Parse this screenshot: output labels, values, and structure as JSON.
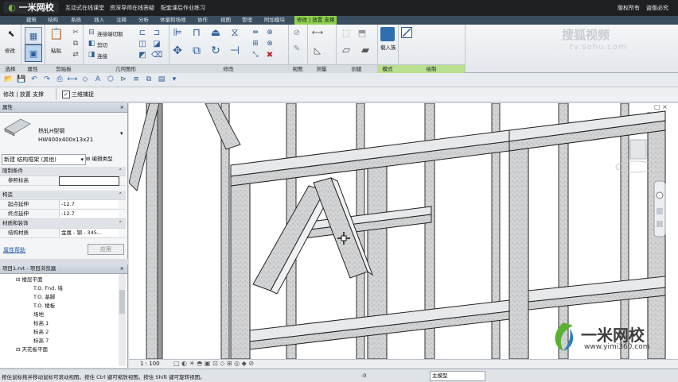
{
  "banner": {
    "logo": "一米网校",
    "links": [
      "互动式在线课堂",
      "资深导师在线答疑",
      "配套课后作业练习"
    ],
    "right": [
      "版权所有",
      "盗版必究"
    ]
  },
  "ribbon_tabs": [
    "建筑",
    "结构",
    "系统",
    "插入",
    "注释",
    "分析",
    "体量和场地",
    "协作",
    "视图",
    "管理",
    "附加模块",
    "修改 | 放置 支撑"
  ],
  "active_tab": "修改 | 放置 支撑",
  "ribbon": {
    "groups": [
      "选择",
      "属性",
      "剪贴板",
      "几何图形",
      "修改",
      "视图",
      "测量",
      "创建",
      "模式",
      "绘制"
    ],
    "modify_label": "修改",
    "paste_label": "粘贴",
    "join_label": "连接端切割",
    "cut_label": "剪切",
    "join2_label": "连接",
    "load_family": "载入族"
  },
  "watermark": {
    "line1": "搜狐视频",
    "line2": "tv.sohu.com"
  },
  "options_bar": {
    "context": "修改 | 放置 支撑",
    "checkbox_label": "三维捕捉"
  },
  "properties": {
    "title": "属性",
    "type_name": "热轧H型钢",
    "type_size": "HW400x400x13x21",
    "selector": "新建 结构框架 (其他)",
    "edit_type": "编辑类型",
    "sections": [
      {
        "name": "限制条件",
        "rows": [
          {
            "name": "参照标高",
            "value": ""
          }
        ]
      },
      {
        "name": "构造",
        "rows": [
          {
            "name": "起点延伸",
            "value": "-12.7"
          },
          {
            "name": "终点延伸",
            "value": "-12.7"
          }
        ]
      },
      {
        "name": "材质和装饰",
        "rows": [
          {
            "name": "结构材质",
            "value": "金属 - 钢 - 345..."
          }
        ]
      }
    ],
    "help": "属性帮助",
    "apply": "应用"
  },
  "browser": {
    "title": "项目1.rvt - 项目浏览器",
    "items": [
      {
        "label": "楼层平面",
        "indent": 1
      },
      {
        "label": "T.O. Fnd. 墙",
        "indent": 2
      },
      {
        "label": "T.O. 基脚",
        "indent": 2
      },
      {
        "label": "T.O. 楼板",
        "indent": 2
      },
      {
        "label": "场地",
        "indent": 2
      },
      {
        "label": "标高 1",
        "indent": 2
      },
      {
        "label": "标高 2",
        "indent": 2
      },
      {
        "label": "标高 7",
        "indent": 2
      },
      {
        "label": "天花板平面",
        "indent": 1
      }
    ]
  },
  "view_control": {
    "scale": "1 : 100"
  },
  "status": {
    "hint": "按住鼠标拖并移动鼠标可滚动视图。按住 Ctrl 键可缩放视图。按住 Shift 键可旋转视图。",
    "model": "主模型",
    "zero": ":0"
  },
  "brand": {
    "name": "一米网校",
    "url": "www.yimi360.com"
  },
  "colors": {
    "ribbon_active": "#8fcf50",
    "title_bar": "#1d1f22",
    "steel": "#c8c9ca"
  }
}
